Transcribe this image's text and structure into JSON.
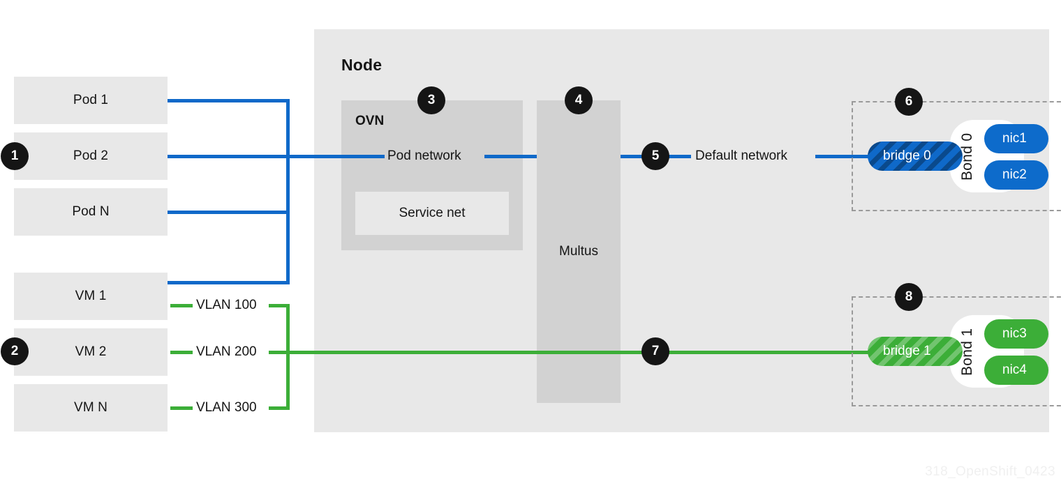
{
  "diagram": {
    "watermark": "318_OpenShift_0423",
    "node_title": "Node",
    "colors": {
      "pod_network_blue": "#0f69c9",
      "vlan_green": "#3cae38",
      "panel_gray": "#e8e8e8",
      "inner_gray": "#d2d2d2",
      "marker_black": "#151515"
    }
  },
  "workloads": {
    "pods": [
      {
        "label": "Pod 1"
      },
      {
        "label": "Pod 2"
      },
      {
        "label": "Pod N"
      }
    ],
    "vms": [
      {
        "label": "VM 1"
      },
      {
        "label": "VM 2"
      },
      {
        "label": "VM N"
      }
    ]
  },
  "vlans": [
    {
      "label": "VLAN 100"
    },
    {
      "label": "VLAN 200"
    },
    {
      "label": "VLAN 300"
    }
  ],
  "node": {
    "title": "Node",
    "ovn": {
      "label": "OVN",
      "pod_network": "Pod network",
      "service_net": "Service net"
    },
    "multus": {
      "label": "Multus"
    },
    "default_network": "Default network"
  },
  "bonds": [
    {
      "bond_label": "Bond 0",
      "bridge": "bridge 0",
      "nics": [
        "nic1",
        "nic2"
      ]
    },
    {
      "bond_label": "Bond 1",
      "bridge": "bridge 1",
      "nics": [
        "nic3",
        "nic4"
      ]
    }
  ],
  "markers": [
    {
      "id": "1",
      "number": "1"
    },
    {
      "id": "2",
      "number": "2"
    },
    {
      "id": "3",
      "number": "3"
    },
    {
      "id": "4",
      "number": "4"
    },
    {
      "id": "5",
      "number": "5"
    },
    {
      "id": "6",
      "number": "6"
    },
    {
      "id": "7",
      "number": "7"
    },
    {
      "id": "8",
      "number": "8"
    }
  ]
}
